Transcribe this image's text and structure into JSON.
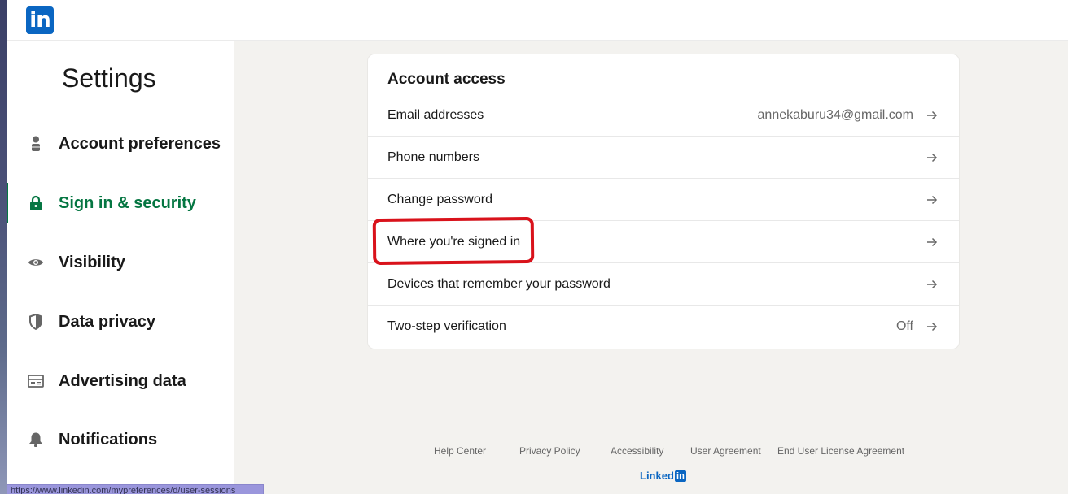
{
  "header": {
    "logo_text": "in",
    "logo_icon": "linkedin-logo-icon",
    "brand_color": "#0a66c2"
  },
  "sidebar": {
    "title": "Settings",
    "active_color": "#057642",
    "items": [
      {
        "label": "Account preferences",
        "icon": "person-icon",
        "active": false
      },
      {
        "label": "Sign in & security",
        "icon": "lock-icon",
        "active": true
      },
      {
        "label": "Visibility",
        "icon": "eye-icon",
        "active": false
      },
      {
        "label": "Data privacy",
        "icon": "shield-icon",
        "active": false
      },
      {
        "label": "Advertising data",
        "icon": "ad-card-icon",
        "active": false
      },
      {
        "label": "Notifications",
        "icon": "bell-icon",
        "active": false
      }
    ]
  },
  "main": {
    "section_title": "Account access",
    "rows": [
      {
        "label": "Email addresses",
        "value": "annekaburu34@gmail.com",
        "icon": "arrow-right-icon"
      },
      {
        "label": "Phone numbers",
        "value": "",
        "icon": "arrow-right-icon"
      },
      {
        "label": "Change password",
        "value": "",
        "icon": "arrow-right-icon"
      },
      {
        "label": "Where you're signed in",
        "value": "",
        "icon": "arrow-right-icon",
        "highlighted": true
      },
      {
        "label": "Devices that remember your password",
        "value": "",
        "icon": "arrow-right-icon"
      },
      {
        "label": "Two-step verification",
        "value": "Off",
        "icon": "arrow-right-icon"
      }
    ],
    "annotation_color": "#d9121b"
  },
  "footer": {
    "links": [
      "Help Center",
      "Privacy Policy",
      "Accessibility",
      "User Agreement",
      "End User License Agreement"
    ],
    "brand_text": "Linked",
    "brand_badge": "in"
  },
  "status_bar": {
    "url": "https://www.linkedin.com/mypreferences/d/user-sessions"
  }
}
